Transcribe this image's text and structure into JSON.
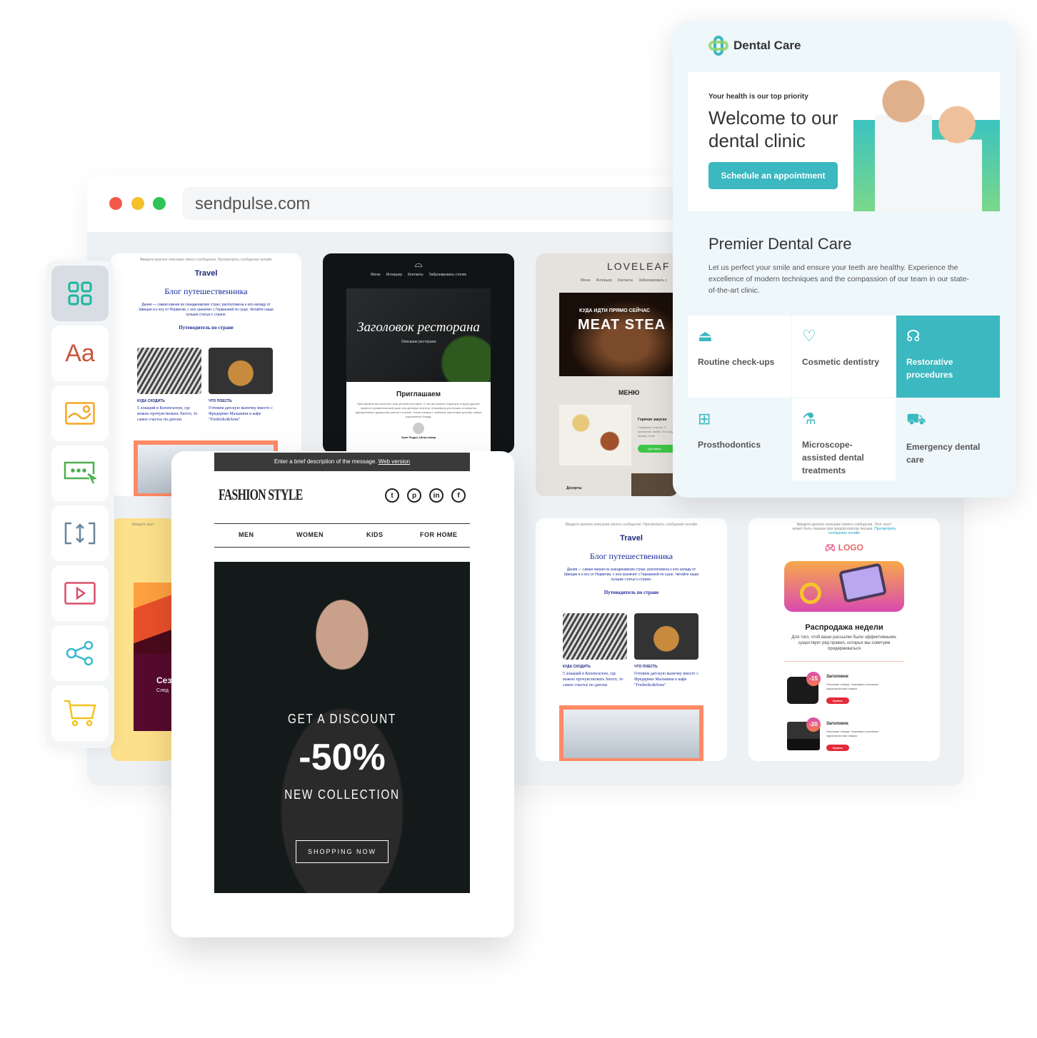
{
  "browser": {
    "url": "sendpulse.com",
    "dots": [
      "#f2594b",
      "#f6c02c",
      "#2fc45a"
    ]
  },
  "sidebar": {
    "items": [
      {
        "icon": "grid-icon",
        "color": "#1bb5a0"
      },
      {
        "icon": "text-icon",
        "label": "Aa",
        "color": "#c8553d"
      },
      {
        "icon": "image-icon",
        "color": "#f5a623"
      },
      {
        "icon": "button-icon",
        "color": "#4caf50"
      },
      {
        "icon": "spacer-icon",
        "color": "#6b8499"
      },
      {
        "icon": "video-icon",
        "color": "#d9506a"
      },
      {
        "icon": "share-icon",
        "color": "#3bb8d0"
      },
      {
        "icon": "cart-icon",
        "color": "#f3c31c"
      }
    ]
  },
  "travel": {
    "preheader": "Введите краткое описание своего сообщения. Просмотреть сообщение онлайн",
    "logo": "Travel",
    "logo_script": "type",
    "title": "Блог путешественника",
    "intro": "Дания — самая южная из скандинавских стран; расположена к юго-западу от Швеции и к югу от Норвегии, с юга граничит с Германией по суше. Читайте наши лучшие статьи о стране.",
    "section": "Путеводитель по стране",
    "articles": [
      {
        "tag": "КУДА СХОДИТЬ",
        "title": "5 локаций в Копенгагене, где можно прочувствовать Хюгге, то самое счастье по-датски"
      },
      {
        "tag": "ЧТО ПОЕСТЬ",
        "title": "Готовим датскую выпечку вместе с Фредерико Мальвини в кафе \"Frederiko&Sons\""
      }
    ]
  },
  "restaurant": {
    "nav": [
      "Меню",
      "Интерьер",
      "Контакты",
      "Забронировать столик"
    ],
    "hero_title": "Заголовок ресторана",
    "hero_sub": "Описание ресторана",
    "heading": "Приглашаем",
    "body": "Приглашаем вас посетить наш уютный ресторан. У нас вы можете отдохнуть в кругу друзей, провести романтический ужин или деловую встречу. Атмосфера ресторана отличается одновременно домашним уютом и стилем. Наши повара с любовью приготовят для вас самые изысканные блюда.",
    "chef": "Хуан Педро, Шеф-повар"
  },
  "loveleaf": {
    "logo": "LOVELEAF",
    "nav": [
      "Меню",
      "Интерьер",
      "Контакты",
      "Забронировать с"
    ],
    "kicker": "КУДА ИДТИ ПРЯМО СЕЙЧАС",
    "hero": "MEAT STEA",
    "menu": "МЕНЮ",
    "dish_title": "Горячие закуски",
    "dish_desc": "Сэндвичи с сыром, С шпинатом, Кибби, Фа Сукук, Манеж, Лепе",
    "cta": "Доставим",
    "desserts": "Десерты"
  },
  "season": {
    "preheader": "Введите крат",
    "title": "Сез",
    "sub": "След"
  },
  "fashion": {
    "preheader": "Enter a brief description of the message.",
    "web_version": "Web version",
    "logo": "FASHION STYLE",
    "social": [
      {
        "icon": "twitter-icon",
        "glyph": "t"
      },
      {
        "icon": "pinterest-icon",
        "glyph": "p"
      },
      {
        "icon": "linkedin-icon",
        "glyph": "in"
      },
      {
        "icon": "facebook-icon",
        "glyph": "f"
      }
    ],
    "nav": [
      "MEN",
      "WOMEN",
      "KIDS",
      "FOR HOME"
    ],
    "promo_top": "GET A DISCOUNT",
    "promo_big": "-50%",
    "promo_bottom": "NEW COLLECTION",
    "cta": "SHOPPING NOW"
  },
  "sale": {
    "preheader": "Введите краткое описание своего сообщения. Этот текст может быть показан при предпросмотре письма.",
    "preheader_link": "Просмотреть сообщение онлайн",
    "logo": "LOGO",
    "title": "Распродажа недели",
    "desc": "Для того, чтоб ваши рассылки были эффективными, существует ряд правил, которых мы советуем придерживаться",
    "products": [
      {
        "badge": "-15",
        "title": "Заголовок",
        "desc": "Описание товара. Указывать основные характеристики товара",
        "cta": "Купить"
      },
      {
        "badge": "-20",
        "title": "Заголовок",
        "desc": "Описание товара. Указывать основные характеристики товара",
        "cta": "Купить"
      }
    ]
  },
  "dental": {
    "logo": "Dental Care",
    "kicker": "Your health is our top priority",
    "title": "Welcome to our dental clinic",
    "cta": "Schedule an appointment",
    "section_title": "Premier Dental Care",
    "section_body": "Let us perfect your smile and ensure your teeth are healthy. Experience the excellence of modern techniques and the compassion of our team in our state-of-the-art clinic.",
    "accent": "#3bb8c0",
    "services": [
      {
        "icon": "alarm-icon",
        "label": "Routine check-ups"
      },
      {
        "icon": "heart-tooth-icon",
        "label": "Cosmetic dentistry"
      },
      {
        "icon": "stethoscope-icon",
        "label": "Restorative procedures",
        "active": true
      },
      {
        "icon": "first-aid-kit-icon",
        "label": "Prosthodontics"
      },
      {
        "icon": "microscope-icon",
        "label": "Microscope-assisted dental treatments"
      },
      {
        "icon": "ambulance-icon",
        "label": "Emergency dental care"
      }
    ]
  }
}
